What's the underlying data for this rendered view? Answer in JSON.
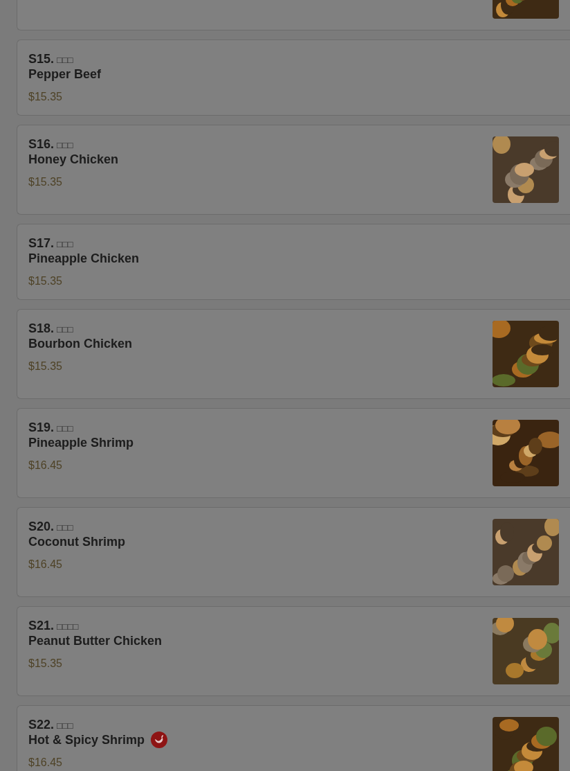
{
  "items": [
    {
      "kind": "partial",
      "spicy": false
    },
    {
      "kind": "dish",
      "code": "S15.",
      "chinese": "□□□",
      "name": "Pepper Beef",
      "price": "$15.35",
      "spicy": false
    },
    {
      "kind": "dish",
      "code": "S16.",
      "chinese": "□□□",
      "name": "Honey Chicken",
      "price": "$15.35",
      "spicy": false
    },
    {
      "kind": "dish",
      "code": "S17.",
      "chinese": "□□□",
      "name": "Pineapple Chicken",
      "price": "$15.35",
      "spicy": false
    },
    {
      "kind": "dish",
      "code": "S18.",
      "chinese": "□□□",
      "name": "Bourbon Chicken",
      "price": "$15.35",
      "spicy": false
    },
    {
      "kind": "dish",
      "code": "S19.",
      "chinese": "□□□",
      "name": "Pineapple Shrimp",
      "price": "$16.45",
      "spicy": false
    },
    {
      "kind": "dish",
      "code": "S20.",
      "chinese": "□□□",
      "name": "Coconut Shrimp",
      "price": "$16.45",
      "spicy": false
    },
    {
      "kind": "dish",
      "code": "S21.",
      "chinese": "□□□□",
      "name": "Peanut Butter Chicken",
      "price": "$15.35",
      "spicy": false
    },
    {
      "kind": "dish",
      "code": "S22.",
      "chinese": "□□□",
      "name": "Hot & Spicy Shrimp",
      "price": "$16.45",
      "spicy": true
    }
  ]
}
